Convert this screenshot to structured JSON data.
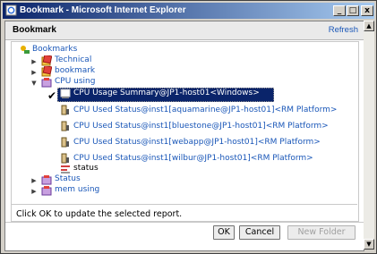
{
  "window": {
    "title": "Bookmark - Microsoft Internet Explorer",
    "minimize": "_",
    "maximize": "□",
    "close": "x"
  },
  "panel": {
    "title": "Bookmark",
    "refresh": "Refresh"
  },
  "tree": {
    "root": "Bookmarks",
    "folders": [
      {
        "label": "Technical",
        "expanded": false
      },
      {
        "label": "bookmark",
        "expanded": false
      },
      {
        "label": "CPU using",
        "expanded": true
      },
      {
        "label": "Status",
        "expanded": false
      },
      {
        "label": "mem using",
        "expanded": false
      }
    ],
    "cpu_children": [
      {
        "label": "CPU Usage Summary@JP1-host01<Windows>",
        "selected": true
      },
      {
        "label": "CPU Used Status@inst1[aquamarine@JP1-host01]<RM Platform>",
        "selected": false
      },
      {
        "label": "CPU Used Status@inst1[bluestone@JP1-host01]<RM Platform>",
        "selected": false
      },
      {
        "label": "CPU Used Status@inst1[webapp@JP1-host01]<RM Platform>",
        "selected": false
      },
      {
        "label": "CPU Used Status@inst1[wilbur@JP1-host01]<RM Platform>",
        "selected": false
      },
      {
        "label": "status",
        "selected": false
      }
    ]
  },
  "message": "Click OK to update the selected report.",
  "buttons": {
    "ok": "OK",
    "cancel": "Cancel",
    "new_folder": "New Folder"
  },
  "colors": {
    "link": "#1a57b8",
    "selection": "#0a246a",
    "titlebar": "#0a246a"
  }
}
